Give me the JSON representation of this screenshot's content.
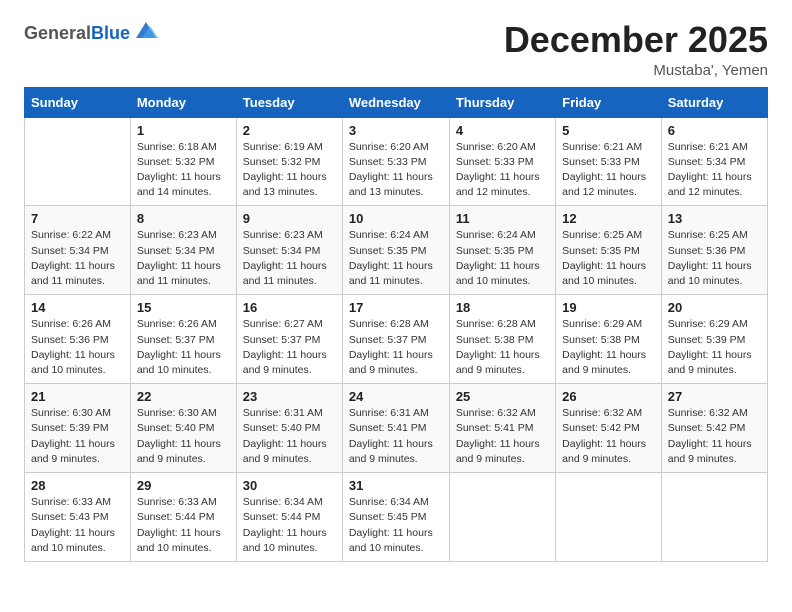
{
  "logo": {
    "general": "General",
    "blue": "Blue"
  },
  "title": "December 2025",
  "location": "Mustaba', Yemen",
  "header": {
    "days": [
      "Sunday",
      "Monday",
      "Tuesday",
      "Wednesday",
      "Thursday",
      "Friday",
      "Saturday"
    ]
  },
  "weeks": [
    [
      {
        "day": "",
        "sunrise": "",
        "sunset": "",
        "daylight": ""
      },
      {
        "day": "1",
        "sunrise": "Sunrise: 6:18 AM",
        "sunset": "Sunset: 5:32 PM",
        "daylight": "Daylight: 11 hours and 14 minutes."
      },
      {
        "day": "2",
        "sunrise": "Sunrise: 6:19 AM",
        "sunset": "Sunset: 5:32 PM",
        "daylight": "Daylight: 11 hours and 13 minutes."
      },
      {
        "day": "3",
        "sunrise": "Sunrise: 6:20 AM",
        "sunset": "Sunset: 5:33 PM",
        "daylight": "Daylight: 11 hours and 13 minutes."
      },
      {
        "day": "4",
        "sunrise": "Sunrise: 6:20 AM",
        "sunset": "Sunset: 5:33 PM",
        "daylight": "Daylight: 11 hours and 12 minutes."
      },
      {
        "day": "5",
        "sunrise": "Sunrise: 6:21 AM",
        "sunset": "Sunset: 5:33 PM",
        "daylight": "Daylight: 11 hours and 12 minutes."
      },
      {
        "day": "6",
        "sunrise": "Sunrise: 6:21 AM",
        "sunset": "Sunset: 5:34 PM",
        "daylight": "Daylight: 11 hours and 12 minutes."
      }
    ],
    [
      {
        "day": "7",
        "sunrise": "Sunrise: 6:22 AM",
        "sunset": "Sunset: 5:34 PM",
        "daylight": "Daylight: 11 hours and 11 minutes."
      },
      {
        "day": "8",
        "sunrise": "Sunrise: 6:23 AM",
        "sunset": "Sunset: 5:34 PM",
        "daylight": "Daylight: 11 hours and 11 minutes."
      },
      {
        "day": "9",
        "sunrise": "Sunrise: 6:23 AM",
        "sunset": "Sunset: 5:34 PM",
        "daylight": "Daylight: 11 hours and 11 minutes."
      },
      {
        "day": "10",
        "sunrise": "Sunrise: 6:24 AM",
        "sunset": "Sunset: 5:35 PM",
        "daylight": "Daylight: 11 hours and 11 minutes."
      },
      {
        "day": "11",
        "sunrise": "Sunrise: 6:24 AM",
        "sunset": "Sunset: 5:35 PM",
        "daylight": "Daylight: 11 hours and 10 minutes."
      },
      {
        "day": "12",
        "sunrise": "Sunrise: 6:25 AM",
        "sunset": "Sunset: 5:35 PM",
        "daylight": "Daylight: 11 hours and 10 minutes."
      },
      {
        "day": "13",
        "sunrise": "Sunrise: 6:25 AM",
        "sunset": "Sunset: 5:36 PM",
        "daylight": "Daylight: 11 hours and 10 minutes."
      }
    ],
    [
      {
        "day": "14",
        "sunrise": "Sunrise: 6:26 AM",
        "sunset": "Sunset: 5:36 PM",
        "daylight": "Daylight: 11 hours and 10 minutes."
      },
      {
        "day": "15",
        "sunrise": "Sunrise: 6:26 AM",
        "sunset": "Sunset: 5:37 PM",
        "daylight": "Daylight: 11 hours and 10 minutes."
      },
      {
        "day": "16",
        "sunrise": "Sunrise: 6:27 AM",
        "sunset": "Sunset: 5:37 PM",
        "daylight": "Daylight: 11 hours and 9 minutes."
      },
      {
        "day": "17",
        "sunrise": "Sunrise: 6:28 AM",
        "sunset": "Sunset: 5:37 PM",
        "daylight": "Daylight: 11 hours and 9 minutes."
      },
      {
        "day": "18",
        "sunrise": "Sunrise: 6:28 AM",
        "sunset": "Sunset: 5:38 PM",
        "daylight": "Daylight: 11 hours and 9 minutes."
      },
      {
        "day": "19",
        "sunrise": "Sunrise: 6:29 AM",
        "sunset": "Sunset: 5:38 PM",
        "daylight": "Daylight: 11 hours and 9 minutes."
      },
      {
        "day": "20",
        "sunrise": "Sunrise: 6:29 AM",
        "sunset": "Sunset: 5:39 PM",
        "daylight": "Daylight: 11 hours and 9 minutes."
      }
    ],
    [
      {
        "day": "21",
        "sunrise": "Sunrise: 6:30 AM",
        "sunset": "Sunset: 5:39 PM",
        "daylight": "Daylight: 11 hours and 9 minutes."
      },
      {
        "day": "22",
        "sunrise": "Sunrise: 6:30 AM",
        "sunset": "Sunset: 5:40 PM",
        "daylight": "Daylight: 11 hours and 9 minutes."
      },
      {
        "day": "23",
        "sunrise": "Sunrise: 6:31 AM",
        "sunset": "Sunset: 5:40 PM",
        "daylight": "Daylight: 11 hours and 9 minutes."
      },
      {
        "day": "24",
        "sunrise": "Sunrise: 6:31 AM",
        "sunset": "Sunset: 5:41 PM",
        "daylight": "Daylight: 11 hours and 9 minutes."
      },
      {
        "day": "25",
        "sunrise": "Sunrise: 6:32 AM",
        "sunset": "Sunset: 5:41 PM",
        "daylight": "Daylight: 11 hours and 9 minutes."
      },
      {
        "day": "26",
        "sunrise": "Sunrise: 6:32 AM",
        "sunset": "Sunset: 5:42 PM",
        "daylight": "Daylight: 11 hours and 9 minutes."
      },
      {
        "day": "27",
        "sunrise": "Sunrise: 6:32 AM",
        "sunset": "Sunset: 5:42 PM",
        "daylight": "Daylight: 11 hours and 9 minutes."
      }
    ],
    [
      {
        "day": "28",
        "sunrise": "Sunrise: 6:33 AM",
        "sunset": "Sunset: 5:43 PM",
        "daylight": "Daylight: 11 hours and 10 minutes."
      },
      {
        "day": "29",
        "sunrise": "Sunrise: 6:33 AM",
        "sunset": "Sunset: 5:44 PM",
        "daylight": "Daylight: 11 hours and 10 minutes."
      },
      {
        "day": "30",
        "sunrise": "Sunrise: 6:34 AM",
        "sunset": "Sunset: 5:44 PM",
        "daylight": "Daylight: 11 hours and 10 minutes."
      },
      {
        "day": "31",
        "sunrise": "Sunrise: 6:34 AM",
        "sunset": "Sunset: 5:45 PM",
        "daylight": "Daylight: 11 hours and 10 minutes."
      },
      {
        "day": "",
        "sunrise": "",
        "sunset": "",
        "daylight": ""
      },
      {
        "day": "",
        "sunrise": "",
        "sunset": "",
        "daylight": ""
      },
      {
        "day": "",
        "sunrise": "",
        "sunset": "",
        "daylight": ""
      }
    ]
  ]
}
